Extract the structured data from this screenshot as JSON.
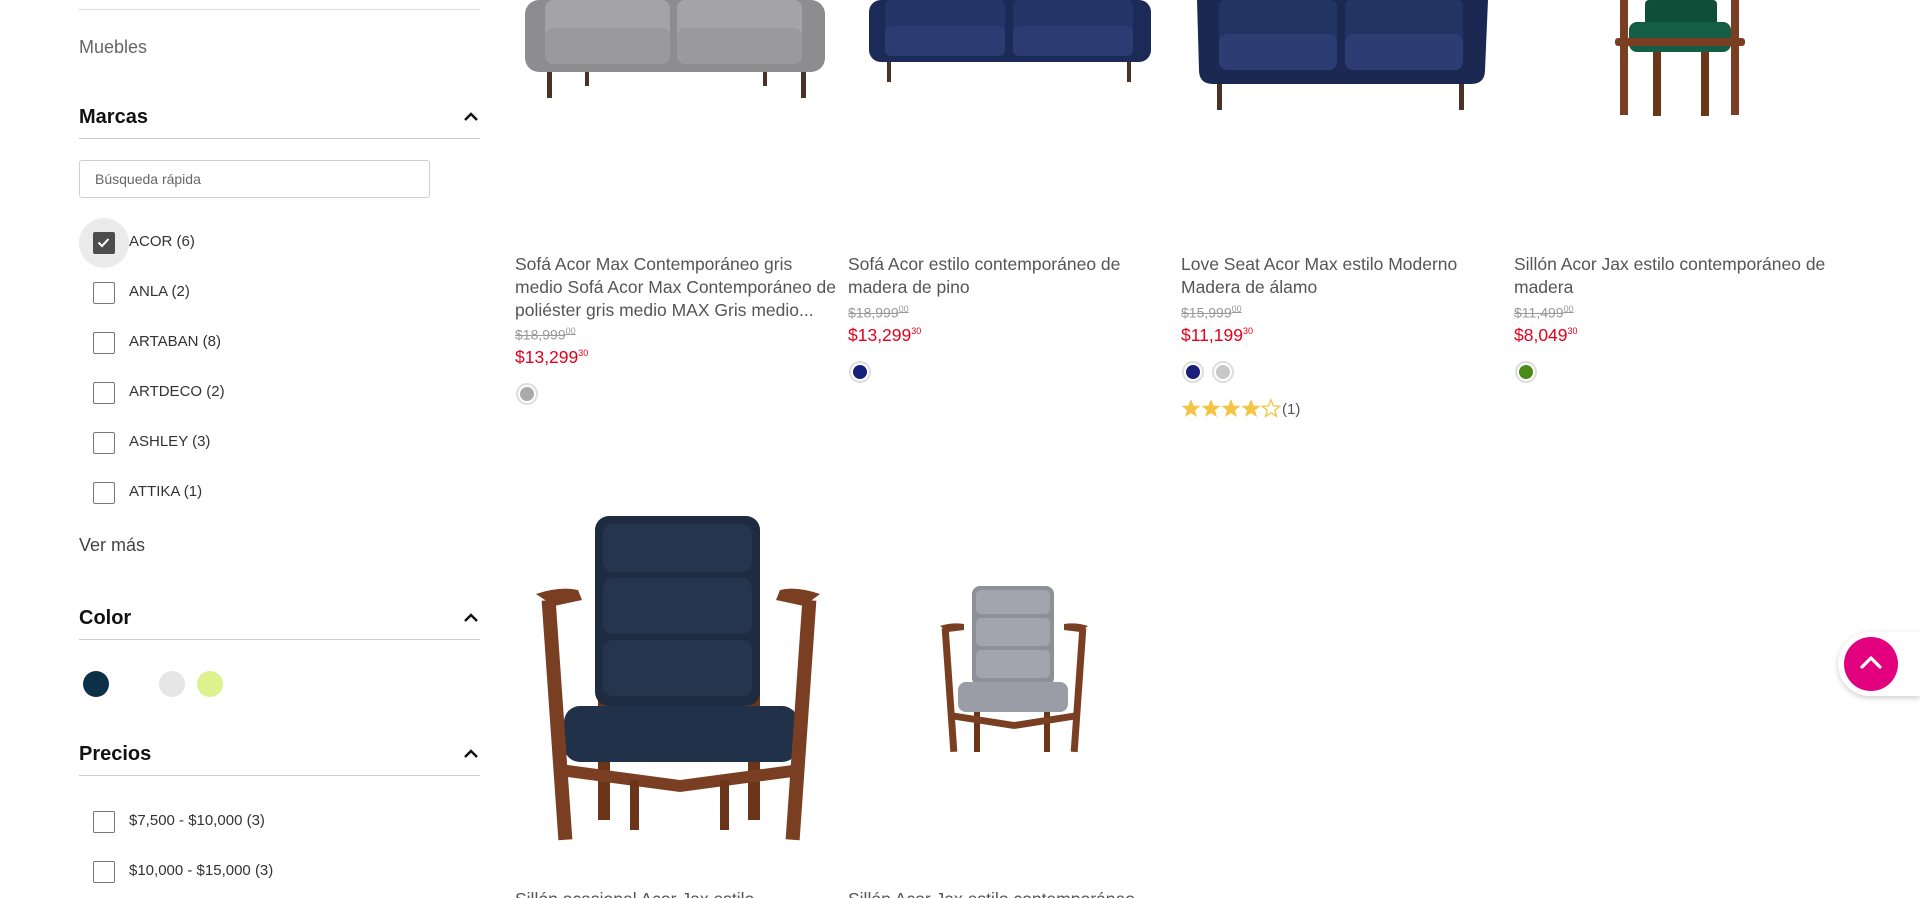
{
  "sidebar": {
    "category_link": "Muebles",
    "brands": {
      "title": "Marcas",
      "search_placeholder": "Búsqueda rápida",
      "items": [
        {
          "label": "ACOR (6)",
          "checked": true
        },
        {
          "label": "ANLA (2)",
          "checked": false
        },
        {
          "label": "ARTABAN (8)",
          "checked": false
        },
        {
          "label": "ARTDECO (2)",
          "checked": false
        },
        {
          "label": "ASHLEY (3)",
          "checked": false
        },
        {
          "label": "ATTIKA (1)",
          "checked": false
        }
      ],
      "more_label": "Ver más"
    },
    "color": {
      "title": "Color",
      "swatches": [
        "#0d3049",
        "#ffffff",
        "#e6e6e6",
        "#ddf28c"
      ]
    },
    "prices": {
      "title": "Precios",
      "items": [
        {
          "label": "$7,500 - $10,000 (3)",
          "checked": false
        },
        {
          "label": "$10,000 - $15,000 (3)",
          "checked": false
        }
      ]
    }
  },
  "products": [
    {
      "title": "Sofá Acor Max Contemporáneo gris medio Sofá Acor Max Contemporáneo de poliéster gris medio MAX Gris medio...",
      "old_price": "$18,999",
      "old_cents": "00",
      "price": "$13,299",
      "price_cents": "30",
      "colors": [
        "#aaaaaa"
      ]
    },
    {
      "title": "Sofá Acor estilo contemporáneo de madera de pino",
      "old_price": "$18,999",
      "old_cents": "00",
      "price": "$13,299",
      "price_cents": "30",
      "colors": [
        "#1a1f7a"
      ]
    },
    {
      "title": "Love Seat Acor Max estilo Moderno Madera de álamo",
      "old_price": "$15,999",
      "old_cents": "00",
      "price": "$11,199",
      "price_cents": "30",
      "colors": [
        "#1a1f7a",
        "#c8c8c8"
      ],
      "rating": 4,
      "rating_count": "(1)"
    },
    {
      "title": "Sillón Acor Jax estilo contemporáneo de madera",
      "old_price": "$11,499",
      "old_cents": "00",
      "price": "$8,049",
      "price_cents": "30",
      "colors": [
        "#4a8a16"
      ]
    },
    {
      "title": "Sillón ocasional Acor Jax estilo..."
    },
    {
      "title": "Sillón Acor Jax estilo contemporáneo de..."
    }
  ],
  "colors": {
    "accent": "#e3007e",
    "sale_price": "#e3001b",
    "star": "#f4c542"
  },
  "back_to_top_icon": "chevron-up-icon"
}
